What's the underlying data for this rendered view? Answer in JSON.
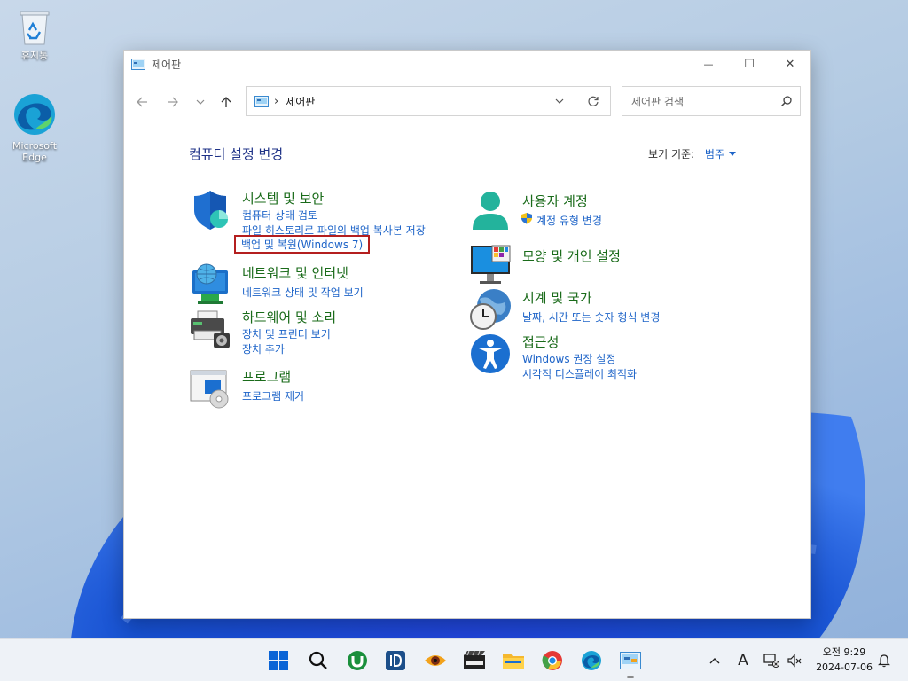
{
  "desktop": {
    "icons": [
      {
        "label": "휴지통"
      },
      {
        "label": "Microsoft Edge"
      }
    ]
  },
  "window": {
    "title": "제어판",
    "controls": {
      "minimize": "—",
      "maximize": "☐",
      "close": "✕"
    },
    "address": {
      "path": "제어판"
    },
    "search": {
      "placeholder": "제어판 검색"
    },
    "heading": "컴퓨터 설정 변경",
    "view_by": {
      "label": "보기 기준:",
      "value": "범주"
    },
    "categories": [
      {
        "title": "시스템 및 보안",
        "links": [
          "컴퓨터 상태 검토",
          "파일 히스토리로 파일의 백업 복사본 저장",
          "백업 및 복원(Windows 7)"
        ],
        "icon": "shield-icon"
      },
      {
        "title": "네트워크 및 인터넷",
        "links": [
          "네트워크 상태 및 작업 보기"
        ],
        "icon": "network-icon"
      },
      {
        "title": "하드웨어 및 소리",
        "links": [
          "장치 및 프린터 보기",
          "장치 추가"
        ],
        "icon": "printer-icon"
      },
      {
        "title": "프로그램",
        "links": [
          "프로그램 제거"
        ],
        "icon": "programs-icon"
      },
      {
        "title": "사용자 계정",
        "links": [
          "계정 유형 변경"
        ],
        "icon": "user-icon"
      },
      {
        "title": "모양 및 개인 설정",
        "links": [],
        "icon": "monitor-icon"
      },
      {
        "title": "시계 및 국가",
        "links": [
          "날짜, 시간 또는 숫자 형식 변경"
        ],
        "icon": "clock-globe-icon"
      },
      {
        "title": "접근성",
        "links": [
          "Windows 권장 설정",
          "시각적 디스플레이 최적화"
        ],
        "icon": "accessibility-icon"
      }
    ]
  },
  "taskbar": {
    "apps": [
      "start-icon",
      "search-icon",
      "utorrent-icon",
      "app-1d-icon",
      "eye-app-icon",
      "mpc-hc-icon",
      "file-explorer-icon",
      "chrome-icon",
      "edge-icon",
      "control-panel-icon"
    ],
    "tray": {
      "language": "A"
    },
    "clock": {
      "time": "오전 9:29",
      "date": "2024-07-06"
    }
  },
  "colors": {
    "heading": "#1e3287",
    "category_title": "#1a6b1a",
    "link": "#1e64c8",
    "highlight_border": "#b41f1f"
  }
}
